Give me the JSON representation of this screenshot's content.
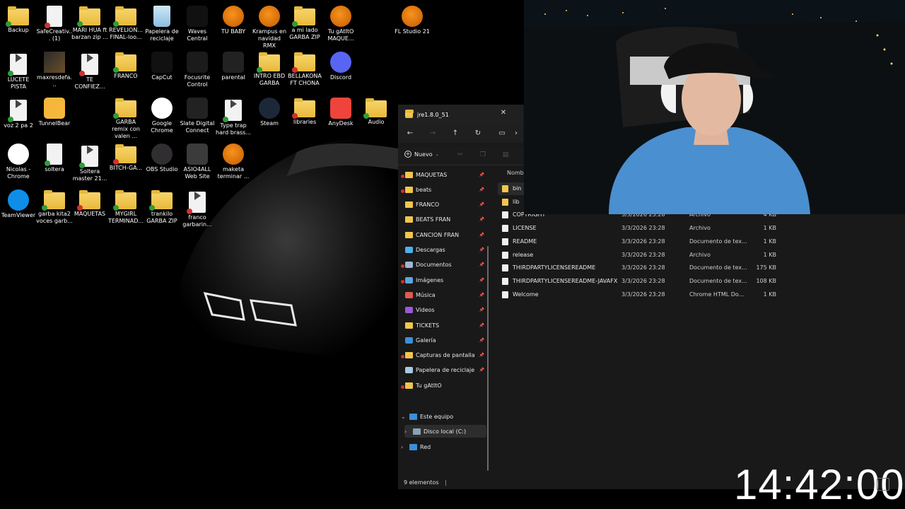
{
  "desktop": {
    "icons": [
      {
        "label": "Backup",
        "kind": "folder"
      },
      {
        "label": "SafeCreativ... (1)",
        "kind": "doc"
      },
      {
        "label": "MARI HUA ft barzan zip ...",
        "kind": "folder"
      },
      {
        "label": "REVELION... FINAL-loo...",
        "kind": "folder"
      },
      {
        "label": "Papelera de reciclaje",
        "kind": "recycle"
      },
      {
        "label": "Waves Central",
        "kind": "app"
      },
      {
        "label": "TU BABY",
        "kind": "fl"
      },
      {
        "label": "Krampus en navidad RMX",
        "kind": "fl"
      },
      {
        "label": "a mi lado GARBA ZIP",
        "kind": "folder"
      },
      {
        "label": "Tu gAtItO MAQUE...",
        "kind": "fl"
      },
      {
        "label": "FL Studio 21",
        "kind": "fl"
      },
      {
        "label": "LUCETE PISTA",
        "kind": "media"
      },
      {
        "label": "maxresdefa...",
        "kind": "image"
      },
      {
        "label": "TE CONFIEZ...",
        "kind": "media"
      },
      {
        "label": "FRANCO",
        "kind": "folder"
      },
      {
        "label": "CapCut",
        "kind": "app"
      },
      {
        "label": "Focusrite Control",
        "kind": "app"
      },
      {
        "label": "parental",
        "kind": "app"
      },
      {
        "label": "INTRO EBD GARBA",
        "kind": "folder"
      },
      {
        "label": "BELLAKONA FT CHONA",
        "kind": "folder"
      },
      {
        "label": "Discord",
        "kind": "app"
      },
      {
        "label": "voz 2 pa 2",
        "kind": "media"
      },
      {
        "label": "TunnelBear",
        "kind": "app"
      },
      {
        "label": "GARBA remix con valen ...",
        "kind": "folder"
      },
      {
        "label": "Google Chrome",
        "kind": "app"
      },
      {
        "label": "Slate Digital Connect",
        "kind": "app"
      },
      {
        "label": "Type trap hard brass...",
        "kind": "media"
      },
      {
        "label": "Steam",
        "kind": "app"
      },
      {
        "label": "libraries",
        "kind": "folder"
      },
      {
        "label": "AnyDesk",
        "kind": "app"
      },
      {
        "label": "Audio",
        "kind": "folder"
      },
      {
        "label": "Nicolas - Chrome",
        "kind": "app"
      },
      {
        "label": "soltera",
        "kind": "doc"
      },
      {
        "label": "Soltera master 21...",
        "kind": "media"
      },
      {
        "label": "BITCH-GA...",
        "kind": "folder"
      },
      {
        "label": "OBS Studio",
        "kind": "app"
      },
      {
        "label": "ASIO4ALL Web Site",
        "kind": "app"
      },
      {
        "label": "maketa terminar ...",
        "kind": "fl"
      },
      {
        "label": "TeamViewer",
        "kind": "app"
      },
      {
        "label": "garba kita2 voces garb...",
        "kind": "folder"
      },
      {
        "label": "MAQUETAS",
        "kind": "folder"
      },
      {
        "label": "MYGIRL TERMINAD...",
        "kind": "folder"
      },
      {
        "label": "trankilo GARBA ZIP",
        "kind": "folder"
      },
      {
        "label": "franco garbarin...",
        "kind": "media"
      }
    ]
  },
  "explorer": {
    "tab_title": "jre1.8.0_51",
    "close_label": "✕",
    "new_label": "Nuevo",
    "nav": [
      {
        "label": "MAQUETAS",
        "icon": "folder",
        "pinned": true,
        "mark": true
      },
      {
        "label": "beats",
        "icon": "folder",
        "pinned": true,
        "mark": true
      },
      {
        "label": "FRANCO",
        "icon": "folder",
        "pinned": true,
        "mark": false
      },
      {
        "label": "BEATS FRAN",
        "icon": "folder",
        "pinned": true,
        "mark": false
      },
      {
        "label": "CANCION FRAN",
        "icon": "folder",
        "pinned": true,
        "mark": false
      },
      {
        "label": "Descargas",
        "icon": "download",
        "pinned": true,
        "mark": false
      },
      {
        "label": "Documentos",
        "icon": "document",
        "pinned": true,
        "mark": true
      },
      {
        "label": "Imágenes",
        "icon": "picture",
        "pinned": true,
        "mark": true
      },
      {
        "label": "Música",
        "icon": "music",
        "pinned": true,
        "mark": false
      },
      {
        "label": "Videos",
        "icon": "video",
        "pinned": true,
        "mark": false
      },
      {
        "label": "TICKETS",
        "icon": "folder",
        "pinned": true,
        "mark": false
      },
      {
        "label": "Galería",
        "icon": "gallery",
        "pinned": true,
        "mark": false
      },
      {
        "label": "Capturas de pantalla",
        "icon": "folder",
        "pinned": true,
        "mark": true
      },
      {
        "label": "Papelera de reciclaje",
        "icon": "recycle",
        "pinned": true,
        "mark": false
      },
      {
        "label": "Tu gAtItO",
        "icon": "folder",
        "pinned": false,
        "mark": true
      }
    ],
    "this_pc": "Este equipo",
    "local_disk": "Disco local (C:)",
    "network": "Red",
    "column_name": "Nombre",
    "files": [
      {
        "name": "bin",
        "date": "",
        "type": "",
        "size": "",
        "kind": "folder"
      },
      {
        "name": "lib",
        "date": "",
        "type": "",
        "size": "",
        "kind": "folder"
      },
      {
        "name": "COPYRIGHT",
        "date": "3/3/2026 23:28",
        "type": "Archivo",
        "size": "4 KB",
        "kind": "file"
      },
      {
        "name": "LICENSE",
        "date": "3/3/2026 23:28",
        "type": "Archivo",
        "size": "1 KB",
        "kind": "file"
      },
      {
        "name": "README",
        "date": "3/3/2026 23:28",
        "type": "Documento de tex...",
        "size": "1 KB",
        "kind": "file"
      },
      {
        "name": "release",
        "date": "3/3/2026 23:28",
        "type": "Archivo",
        "size": "1 KB",
        "kind": "file"
      },
      {
        "name": "THIRDPARTYLICENSEREADME",
        "date": "3/3/2026 23:28",
        "type": "Documento de tex...",
        "size": "175 KB",
        "kind": "file"
      },
      {
        "name": "THIRDPARTYLICENSEREADME-JAVAFX",
        "date": "3/3/2026 23:28",
        "type": "Documento de tex...",
        "size": "108 KB",
        "kind": "file"
      },
      {
        "name": "Welcome",
        "date": "3/3/2026 23:28",
        "type": "Chrome HTML Do...",
        "size": "1 KB",
        "kind": "file"
      }
    ],
    "status": "9 elementos"
  },
  "clock": "14:42:00",
  "colors": {
    "folder": "#f1c64b",
    "explorer_bg": "#191919",
    "accent_red": "#d32f2f"
  }
}
